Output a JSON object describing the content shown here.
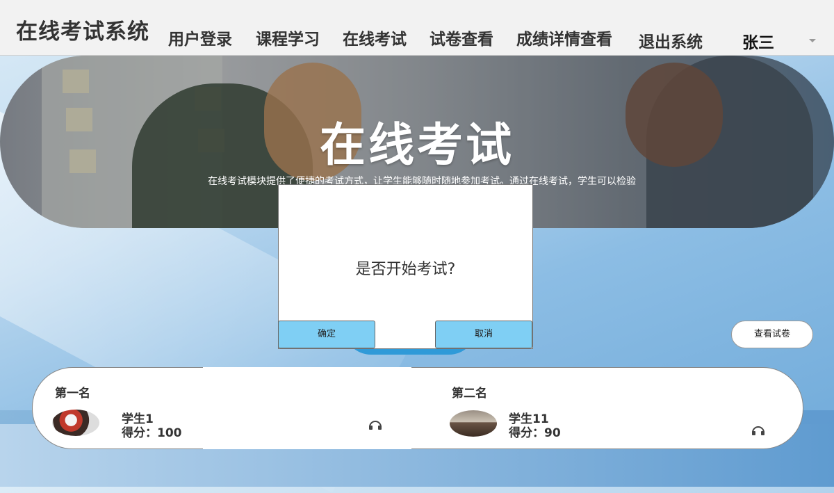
{
  "app": {
    "brand": "在线考试系统"
  },
  "nav": {
    "items": [
      "用户登录",
      "课程学习",
      "在线考试",
      "试卷查看",
      "成绩详情查看",
      "退出系统"
    ],
    "user": "张三"
  },
  "banner": {
    "title": "在线考试",
    "description": "在线考试模块提供了便捷的考试方式，让学生能够随时随地参加考试。通过在线考试，学生可以检验"
  },
  "actions": {
    "view_paper": "查看试卷"
  },
  "ranking": [
    {
      "rank": "第一名",
      "name": "学生1",
      "score": "得分：100"
    },
    {
      "rank": "第二名",
      "name": "学生11",
      "score": "得分：90"
    }
  ],
  "modal": {
    "question": "是否开始考试?",
    "confirm": "确定",
    "cancel": "取消"
  },
  "icons": {
    "dropdown": "chevron-down-icon",
    "audio": "headphone-icon"
  }
}
